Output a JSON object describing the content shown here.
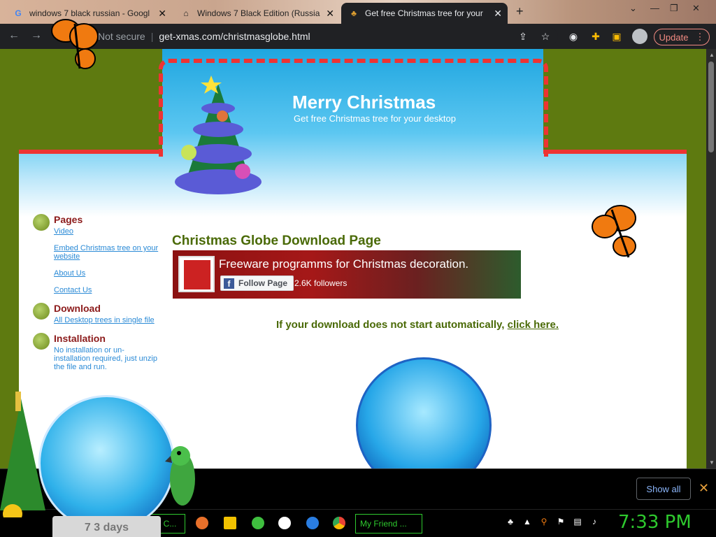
{
  "browser": {
    "tabs": [
      {
        "title": "windows 7 black russian - Googl",
        "icon": "google-icon"
      },
      {
        "title": "Windows 7 Black Edition (Russia",
        "icon": "museum-icon"
      },
      {
        "title": "Get free Christmas tree for your",
        "icon": "christmas-tree-icon"
      }
    ],
    "new_tab": "+",
    "security": "Not secure",
    "url": "get-xmas.com/christmasglobe.html",
    "update_label": "Update"
  },
  "header": {
    "title": "Merry Christmas",
    "subtitle": "Get free Christmas tree for your desktop"
  },
  "sidebar": {
    "pages_title": "Pages",
    "links": [
      "Video",
      "Embed Christmas tree on your website",
      "About Us",
      "Contact Us"
    ],
    "download_title": "Download",
    "download_link": "All Desktop trees in single file",
    "installation_title": "Installation",
    "installation_text": "No installation or un-installation required, just unzip the file and run."
  },
  "main": {
    "title": "Christmas Globe Download Page",
    "facebook": {
      "page_name": "Freeware programms for Christmas decoration.",
      "follow_label": "Follow Page",
      "followers": "2.6K followers"
    },
    "download_text": "If your download does not start automatically,",
    "download_link": "click here."
  },
  "download_bar": {
    "show_all": "Show all"
  },
  "taskbar": {
    "items": [
      {
        "label": "ee C..."
      },
      {
        "label": "My Friend ..."
      }
    ],
    "clock": "7:33 PM"
  },
  "desktop": {
    "countdown": "7 3 days"
  },
  "colors": {
    "page_bg": "#5e7a10",
    "heading_green": "#4a6a07",
    "sidebar_red": "#8b1a1a",
    "link_blue": "#2a8ad6",
    "taskbar_green": "#2ec92e"
  }
}
